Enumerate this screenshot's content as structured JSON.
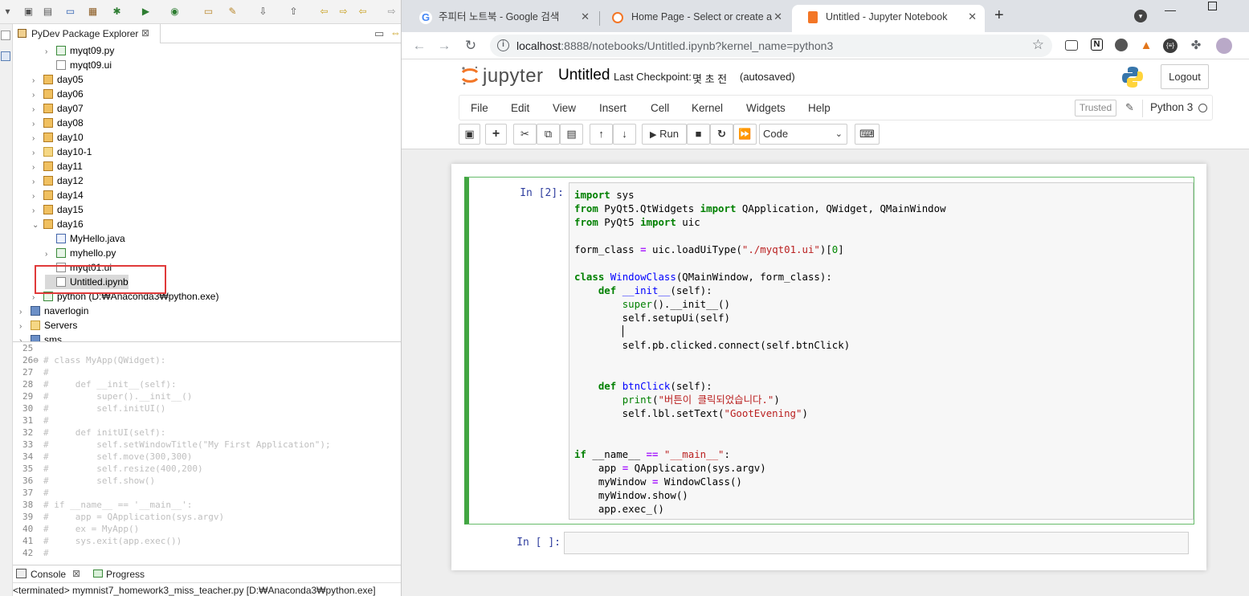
{
  "eclipse": {
    "explorer_tab": "PyDev Package Explorer",
    "tree": [
      {
        "label": "myqt09.py",
        "icon": "python-file-icon",
        "indent": 2,
        "arrow": ">"
      },
      {
        "label": "myqt09.ui",
        "icon": "ui-file-icon",
        "indent": 2,
        "arrow": ""
      },
      {
        "label": "day05",
        "icon": "package-icon",
        "indent": 1,
        "arrow": ">"
      },
      {
        "label": "day06",
        "icon": "package-icon",
        "indent": 1,
        "arrow": ">"
      },
      {
        "label": "day07",
        "icon": "package-icon",
        "indent": 1,
        "arrow": ">"
      },
      {
        "label": "day08",
        "icon": "package-icon",
        "indent": 1,
        "arrow": ">"
      },
      {
        "label": "day10",
        "icon": "package-icon",
        "indent": 1,
        "arrow": ">"
      },
      {
        "label": "day10-1",
        "icon": "folder-icon",
        "indent": 1,
        "arrow": ">"
      },
      {
        "label": "day11",
        "icon": "package-icon",
        "indent": 1,
        "arrow": ">"
      },
      {
        "label": "day12",
        "icon": "package-icon",
        "indent": 1,
        "arrow": ">"
      },
      {
        "label": "day14",
        "icon": "package-icon",
        "indent": 1,
        "arrow": ">"
      },
      {
        "label": "day15",
        "icon": "package-icon",
        "indent": 1,
        "arrow": ">"
      },
      {
        "label": "day16",
        "icon": "package-icon",
        "indent": 1,
        "arrow": "v"
      },
      {
        "label": "MyHello.java",
        "icon": "java-file-icon",
        "indent": 2,
        "arrow": ""
      },
      {
        "label": "myhello.py",
        "icon": "python-file-icon",
        "indent": 2,
        "arrow": ">"
      },
      {
        "label": "myqt01.ui",
        "icon": "ui-file-icon",
        "indent": 2,
        "arrow": ""
      },
      {
        "label": "Untitled.ipynb",
        "icon": "notebook-file-icon",
        "indent": 2,
        "arrow": ""
      },
      {
        "label": "python  (D:₩Anaconda3₩python.exe)",
        "icon": "python-interpreter-icon",
        "indent": 1,
        "arrow": ">"
      },
      {
        "label": "naverlogin",
        "icon": "project-icon",
        "indent": 0,
        "arrow": ">"
      },
      {
        "label": "Servers",
        "icon": "folder-icon",
        "indent": 0,
        "arrow": ">"
      },
      {
        "label": "sms",
        "icon": "project-icon",
        "indent": 0,
        "arrow": ">"
      }
    ],
    "editor_lines": [
      {
        "n": "25",
        "t": ""
      },
      {
        "n": "26⊖",
        "t": "# class MyApp(QWidget):"
      },
      {
        "n": "27",
        "t": "#"
      },
      {
        "n": "28",
        "t": "#     def __init__(self):"
      },
      {
        "n": "29",
        "t": "#         super().__init__()"
      },
      {
        "n": "30",
        "t": "#         self.initUI()"
      },
      {
        "n": "31",
        "t": "#"
      },
      {
        "n": "32",
        "t": "#     def initUI(self):"
      },
      {
        "n": "33",
        "t": "#         self.setWindowTitle(\"My First Application\");"
      },
      {
        "n": "34",
        "t": "#         self.move(300,300)"
      },
      {
        "n": "35",
        "t": "#         self.resize(400,200)"
      },
      {
        "n": "36",
        "t": "#         self.show()"
      },
      {
        "n": "37",
        "t": "#"
      },
      {
        "n": "38",
        "t": "# if __name__ == '__main__':"
      },
      {
        "n": "39",
        "t": "#     app = QApplication(sys.argv)"
      },
      {
        "n": "40",
        "t": "#     ex = MyApp()"
      },
      {
        "n": "41",
        "t": "#     sys.exit(app.exec())"
      },
      {
        "n": "42",
        "t": "#"
      }
    ],
    "console_tab": "Console",
    "progress_tab": "Progress",
    "console_status": "<terminated> mymnist7_homework3_miss_teacher.py [D:₩Anaconda3₩python.exe]"
  },
  "browser": {
    "tabs": [
      {
        "title": "주피터 노트북 - Google 검색",
        "favicon": "google-icon"
      },
      {
        "title": "Home Page - Select or create a",
        "favicon": "jupyter-icon"
      },
      {
        "title": "Untitled - Jupyter Notebook",
        "favicon": "notebook-icon"
      }
    ],
    "url_host": "localhost",
    "url_rest": ":8888/notebooks/Untitled.ipynb?kernel_name=python3"
  },
  "jupyter": {
    "logo_text": "jupyter",
    "notebook_name": "Untitled",
    "checkpoint_label": "Last Checkpoint:",
    "checkpoint_value": "몇 초 전",
    "autosave": "(autosaved)",
    "logout": "Logout",
    "menu": [
      "File",
      "Edit",
      "View",
      "Insert",
      "Cell",
      "Kernel",
      "Widgets",
      "Help"
    ],
    "trusted": "Trusted",
    "kernel": "Python 3",
    "run_label": "Run",
    "cell_type": "Code",
    "cell1_prompt": "In [2]:",
    "cell2_prompt": "In [ ]:"
  }
}
